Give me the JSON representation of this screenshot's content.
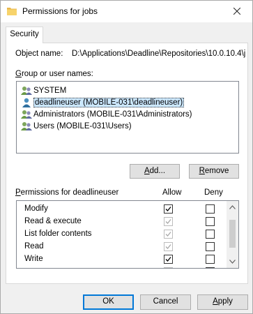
{
  "window": {
    "title": "Permissions for jobs"
  },
  "tabs": [
    {
      "label": "Security"
    }
  ],
  "object": {
    "label": "Object name:",
    "value": "D:\\Applications\\Deadline\\Repositories\\10.0.10.4\\j"
  },
  "groups": {
    "label": "Group or user names:",
    "items": [
      {
        "label": "SYSTEM",
        "icon": "user-group-icon",
        "selected": false
      },
      {
        "label": "deadlineuser (MOBILE-031\\deadlineuser)",
        "icon": "user-icon",
        "selected": true
      },
      {
        "label": "Administrators (MOBILE-031\\Administrators)",
        "icon": "user-group-icon",
        "selected": false
      },
      {
        "label": "Users (MOBILE-031\\Users)",
        "icon": "user-group-icon",
        "selected": false
      }
    ]
  },
  "buttons": {
    "add": "Add...",
    "remove": "Remove",
    "ok": "OK",
    "cancel": "Cancel",
    "apply": "Apply"
  },
  "permissions": {
    "label": "Permissions for deadlineuser",
    "allow_header": "Allow",
    "deny_header": "Deny",
    "rows": [
      {
        "name": "Modify",
        "allow": "checked",
        "deny": "unchecked"
      },
      {
        "name": "Read & execute",
        "allow": "checked-disabled",
        "deny": "unchecked"
      },
      {
        "name": "List folder contents",
        "allow": "checked-disabled",
        "deny": "unchecked"
      },
      {
        "name": "Read",
        "allow": "checked-disabled",
        "deny": "unchecked"
      },
      {
        "name": "Write",
        "allow": "checked",
        "deny": "unchecked"
      },
      {
        "name": "",
        "allow": "checked-disabled",
        "deny": "unchecked"
      }
    ]
  },
  "colors": {
    "selection": "#cce8ff",
    "accent": "#0078d7"
  }
}
